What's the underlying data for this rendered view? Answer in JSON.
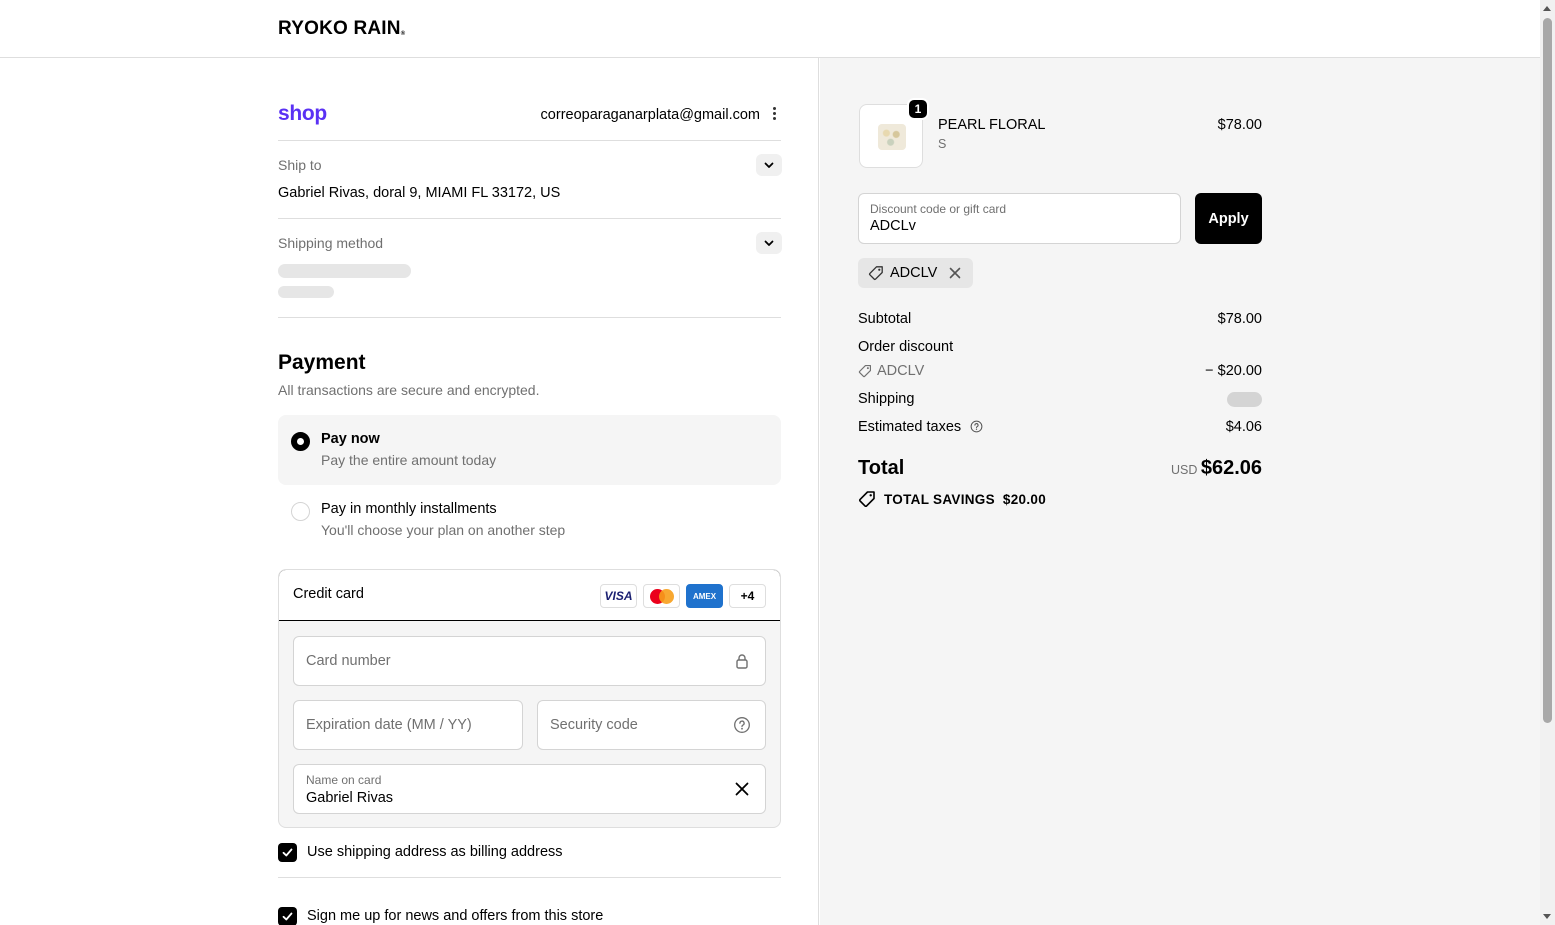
{
  "header": {
    "brand": "RYOKO RAIN",
    "brand_mark": "®"
  },
  "account": {
    "shop_logo": "shop",
    "email": "correoparaganarplata@gmail.com"
  },
  "ship_to": {
    "label": "Ship to",
    "address": "Gabriel Rivas, doral 9, MIAMI FL 33172, US"
  },
  "shipping_method": {
    "label": "Shipping method"
  },
  "payment": {
    "title": "Payment",
    "subtitle": "All transactions are secure and encrypted.",
    "options": [
      {
        "title": "Pay now",
        "subtitle": "Pay the entire amount today",
        "selected": true
      },
      {
        "title": "Pay in monthly installments",
        "subtitle": "You'll choose your plan on another step",
        "selected": false
      }
    ],
    "credit_card": {
      "label": "Credit card",
      "brands": [
        "VISA",
        "Mastercard",
        "AMEX",
        "+4"
      ],
      "card_number_placeholder": "Card number",
      "expiration_placeholder": "Expiration date (MM / YY)",
      "security_placeholder": "Security code",
      "name_label": "Name on card",
      "name_value": "Gabriel Rivas"
    },
    "billing_checkbox": "Use shipping address as billing address",
    "newsletter_checkbox": "Sign me up for news and offers from this store"
  },
  "summary": {
    "product": {
      "name": "PEARL FLORAL",
      "variant": "S",
      "price": "$78.00",
      "quantity": "1"
    },
    "discount_field": {
      "label": "Discount code or gift card",
      "value": "ADCLv"
    },
    "apply_label": "Apply",
    "applied_code": "ADCLV",
    "subtotal_label": "Subtotal",
    "subtotal_value": "$78.00",
    "order_discount_label": "Order discount",
    "discount_code": "ADCLV",
    "discount_value": "− $20.00",
    "shipping_label": "Shipping",
    "taxes_label": "Estimated taxes",
    "taxes_value": "$4.06",
    "total_label": "Total",
    "currency": "USD",
    "total_value": "$62.06",
    "savings_label": "TOTAL SAVINGS",
    "savings_value": "$20.00"
  },
  "colors": {
    "shop_purple": "#5a31f4",
    "accent": "#000000",
    "summary_bg": "#f5f5f5"
  }
}
